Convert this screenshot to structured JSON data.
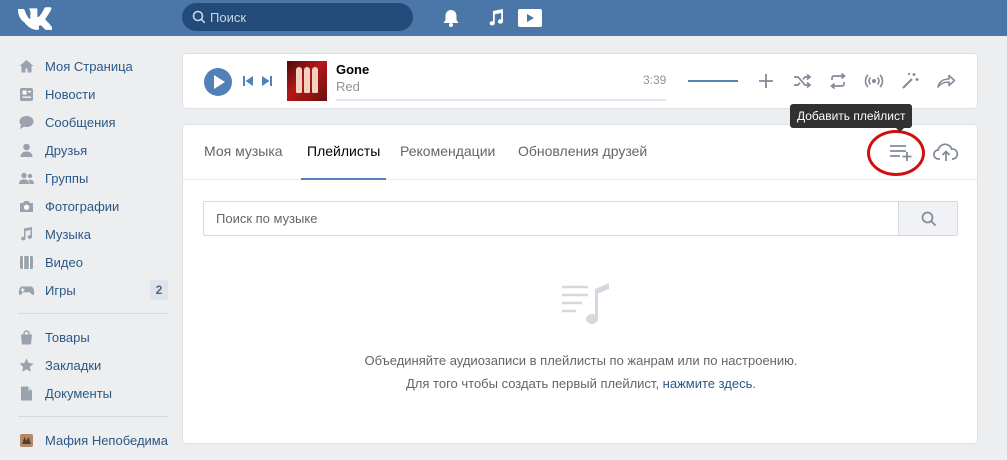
{
  "header": {
    "search_placeholder": "Поиск",
    "icons": [
      "vk-logo-icon",
      "search-icon",
      "bell-icon",
      "music-note-icon",
      "play-video-icon"
    ]
  },
  "sidebar": {
    "items": [
      {
        "label": "Моя Страница",
        "icon": "home-icon"
      },
      {
        "label": "Новости",
        "icon": "news-icon"
      },
      {
        "label": "Сообщения",
        "icon": "messages-icon"
      },
      {
        "label": "Друзья",
        "icon": "user-icon"
      },
      {
        "label": "Группы",
        "icon": "groups-icon"
      },
      {
        "label": "Фотографии",
        "icon": "camera-icon"
      },
      {
        "label": "Музыка",
        "icon": "music-icon"
      },
      {
        "label": "Видео",
        "icon": "video-icon"
      },
      {
        "label": "Игры",
        "icon": "gamepad-icon",
        "badge": "2"
      },
      {
        "label": "Товары",
        "icon": "bag-icon"
      },
      {
        "label": "Закладки",
        "icon": "star-icon"
      },
      {
        "label": "Документы",
        "icon": "document-icon"
      },
      {
        "label": "Мафия Непобедима",
        "icon": "app-icon"
      }
    ]
  },
  "player": {
    "title": "Gone",
    "artist": "Red",
    "time": "3:39"
  },
  "tooltip": "Добавить плейлист",
  "tabs": [
    {
      "label": "Моя музыка",
      "active": false
    },
    {
      "label": "Плейлисты",
      "active": true
    },
    {
      "label": "Рекомендации",
      "active": false
    },
    {
      "label": "Обновления друзей",
      "active": false
    }
  ],
  "music_search": {
    "placeholder": "Поиск по музыке"
  },
  "empty_state": {
    "line1": "Объединяйте аудиозаписи в плейлисты по жанрам или по настроению.",
    "line2_prefix": "Для того чтобы создать первый плейлист, ",
    "line2_link": "нажмите здесь",
    "line2_suffix": "."
  },
  "colors": {
    "header": "#4a76a8",
    "accent": "#5181b8",
    "link": "#2a5885",
    "highlight": "#d01010"
  }
}
